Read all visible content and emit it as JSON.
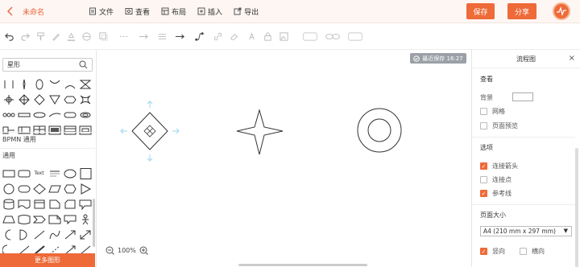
{
  "header": {
    "back_icon": "chevron-left-icon",
    "title": "未命名",
    "menu": [
      {
        "label": "文件",
        "icon": "file-icon"
      },
      {
        "label": "查看",
        "icon": "view-icon"
      },
      {
        "label": "布局",
        "icon": "layout-icon"
      },
      {
        "label": "插入",
        "icon": "insert-icon"
      },
      {
        "label": "导出",
        "icon": "export-icon"
      }
    ],
    "save_label": "保存",
    "share_label": "分享",
    "accent": "#ee6a38"
  },
  "left_panel": {
    "search_value": "星形",
    "categories": [
      "BPMN 通用",
      "通用"
    ],
    "more_label": "更多图形",
    "text_shape_label": "Text"
  },
  "canvas": {
    "autosave_text": "最近保存 16:27",
    "zoom": "100%"
  },
  "right_panel": {
    "title": "流程图",
    "view": {
      "heading": "查看",
      "background_label": "背景",
      "grid_label": "网格",
      "page_preview_label": "页面预览"
    },
    "options": {
      "heading": "选项",
      "items": [
        {
          "label": "连接箭头",
          "checked": true
        },
        {
          "label": "连接点",
          "checked": false
        },
        {
          "label": "参考线",
          "checked": true
        }
      ]
    },
    "page_size": {
      "heading": "页面大小",
      "selected": "A4 (210 mm x 297 mm)",
      "portrait_label": "竖向",
      "landscape_label": "横向",
      "portrait_checked": true
    }
  }
}
